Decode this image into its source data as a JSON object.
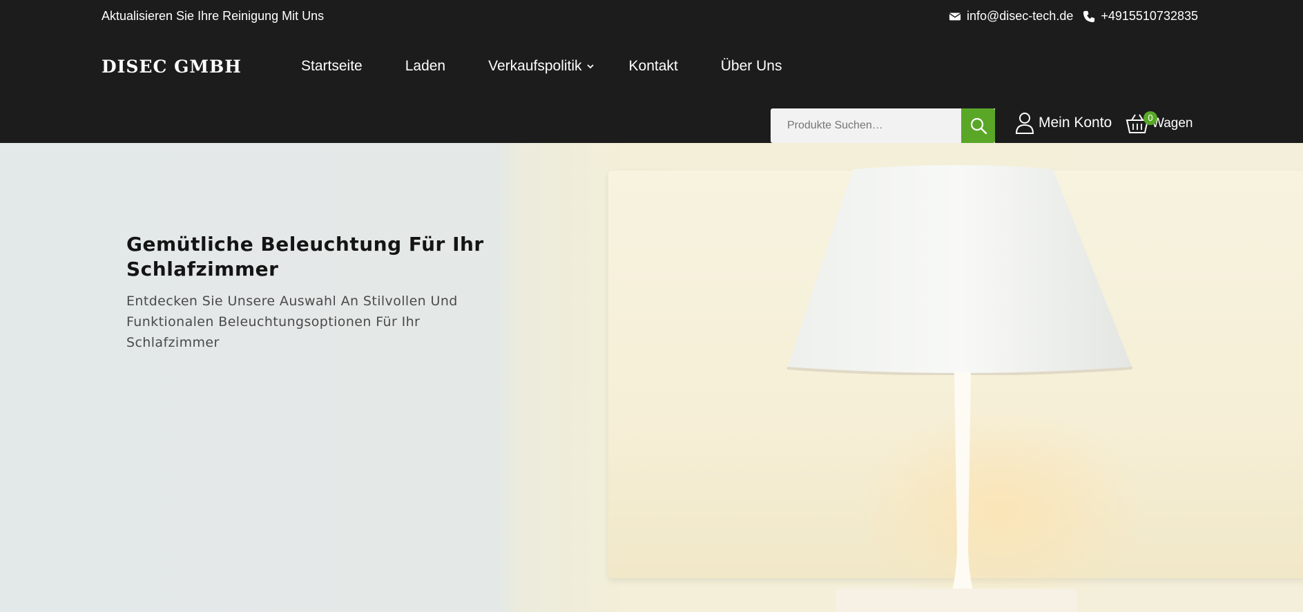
{
  "topbar": {
    "tagline": "Aktualisieren Sie Ihre Reinigung Mit Uns",
    "email": "info@disec-tech.de",
    "phone": "+4915510732835"
  },
  "header": {
    "logo": "DISEC GMBH",
    "menu": [
      {
        "label": "Startseite"
      },
      {
        "label": "Laden"
      },
      {
        "label": "Verkaufspolitik"
      },
      {
        "label": "Kontakt"
      },
      {
        "label": "Über Uns"
      }
    ],
    "search_placeholder": "Produkte Suchen…",
    "account_label": "Mein Konto",
    "cart_label": "Wagen",
    "cart_count": "0"
  },
  "hero": {
    "title": "Gemütliche Beleuchtung Für Ihr Schlafzimmer",
    "subtitle": "Entdecken Sie Unsere Auswahl An Stilvollen Und Funktionalen Beleuchtungsoptionen Für Ihr Schlafzimmer"
  },
  "colors": {
    "header_bg": "#1c1c1c",
    "accent": "#5aa728"
  }
}
